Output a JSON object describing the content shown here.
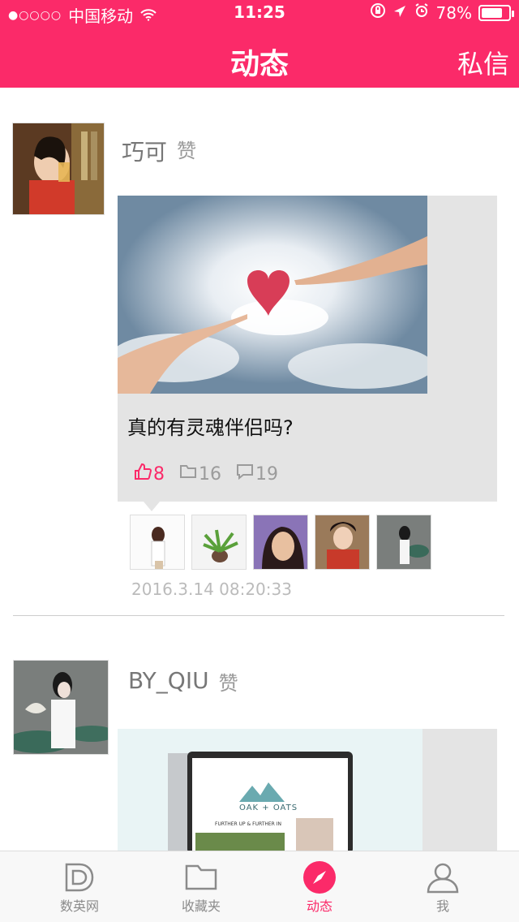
{
  "status": {
    "signal_text": "●○○○○",
    "carrier": "中国移动",
    "time": "11:25",
    "battery": "78%",
    "battery_level": 0.78
  },
  "header": {
    "title": "动态",
    "right_action": "私信"
  },
  "feed": {
    "posts": [
      {
        "author": "巧可",
        "action": "赞",
        "card_title": "真的有灵魂伴侣吗?",
        "likes": "8",
        "saves": "16",
        "comments": "19",
        "date": "2016.3.14    08:20:33"
      },
      {
        "author": "BY_QIU",
        "action": "赞",
        "preview_logo": "OAK + OATS",
        "preview_tag": "FURTHER UP & FURTHER IN"
      }
    ]
  },
  "tabs": [
    {
      "label": "数英网"
    },
    {
      "label": "收藏夹"
    },
    {
      "label": "动态"
    },
    {
      "label": "我"
    }
  ],
  "colors": {
    "accent": "#fb2a69",
    "card_bg": "#e4e4e4"
  }
}
